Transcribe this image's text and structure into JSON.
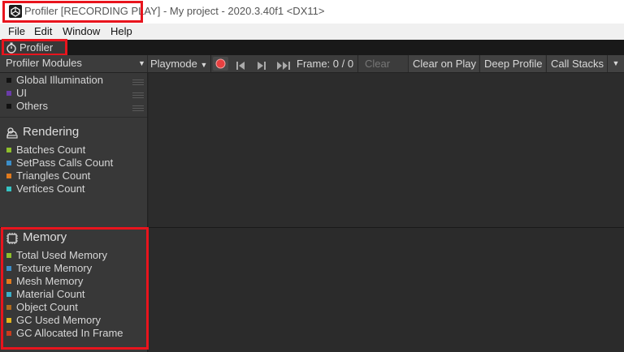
{
  "window": {
    "title_highlight": "Profiler [RECORDING PLAY]",
    "title_rest": " - My project - 2020.3.40f1 <DX11>"
  },
  "menu": {
    "items": [
      "File",
      "Edit",
      "Window",
      "Help"
    ]
  },
  "tab": {
    "label": "Profiler"
  },
  "toolbar": {
    "modules_label": "Profiler Modules",
    "playmode_label": "Playmode",
    "frame_label": "Frame: 0 / 0",
    "clear_label": "Clear",
    "clear_on_play_label": "Clear on Play",
    "deep_profile_label": "Deep Profile",
    "call_stacks_label": "Call Stacks"
  },
  "modules": {
    "misc": [
      {
        "label": "Global Illumination",
        "color": "#111111"
      },
      {
        "label": "UI",
        "color": "#6a3ca8"
      },
      {
        "label": "Others",
        "color": "#111111"
      }
    ],
    "rendering": {
      "title": "Rendering",
      "items": [
        {
          "label": "Batches Count",
          "color": "#8fbf2c"
        },
        {
          "label": "SetPass Calls Count",
          "color": "#3c8ec8"
        },
        {
          "label": "Triangles Count",
          "color": "#e07a1e"
        },
        {
          "label": "Vertices Count",
          "color": "#35c3c3"
        }
      ]
    },
    "memory": {
      "title": "Memory",
      "items": [
        {
          "label": "Total Used Memory",
          "color": "#8fbf2c"
        },
        {
          "label": "Texture Memory",
          "color": "#3c8ec8"
        },
        {
          "label": "Mesh Memory",
          "color": "#e07a1e"
        },
        {
          "label": "Material Count",
          "color": "#3cb0c8"
        },
        {
          "label": "Object Count",
          "color": "#b06a1e"
        },
        {
          "label": "GC Used Memory",
          "color": "#e0b41e"
        },
        {
          "label": "GC Allocated In Frame",
          "color": "#c83c1e"
        }
      ]
    }
  },
  "colors": {
    "highlight": "#e8141d",
    "record": "#e84040"
  }
}
